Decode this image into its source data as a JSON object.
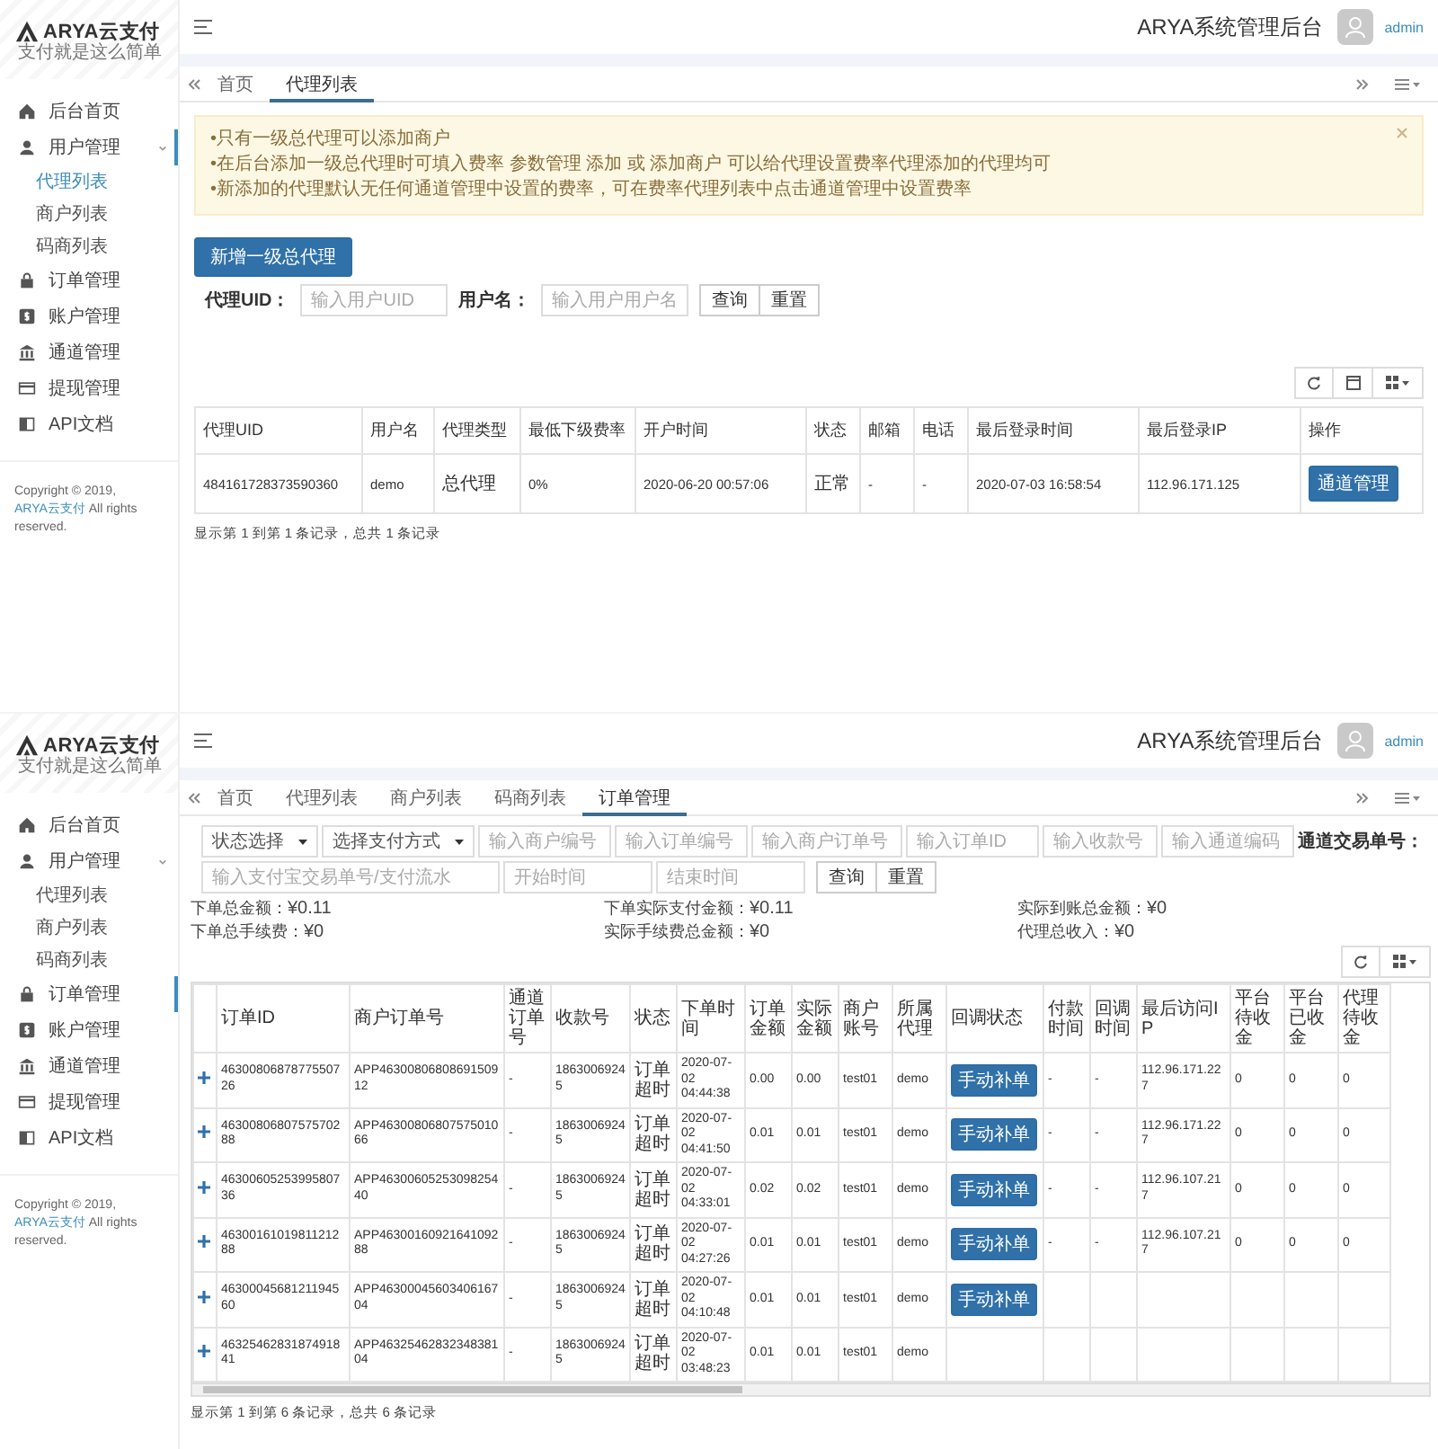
{
  "screens": [
    {
      "kind": "agents",
      "brand": {
        "name": "ARYA云支付",
        "tagline": "支付就是这么简单"
      },
      "sidebar": [
        {
          "label": "后台首页",
          "selected": false
        },
        {
          "label": "用户管理",
          "selected": true,
          "expanded": true,
          "children": [
            {
              "label": "代理列表",
              "selected": true
            },
            {
              "label": "商户列表",
              "selected": false
            },
            {
              "label": "码商列表",
              "selected": false
            }
          ]
        },
        {
          "label": "订单管理",
          "selected": false
        },
        {
          "label": "账户管理",
          "selected": false
        },
        {
          "label": "通道管理",
          "selected": false
        },
        {
          "label": "提现管理",
          "selected": false
        },
        {
          "label": "API文档",
          "selected": false
        }
      ],
      "copyright": {
        "before": "Copyright © 2019, ",
        "link": "ARYA云支付",
        "after": " All rights reserved."
      },
      "header": {
        "title": "ARYA系统管理后台",
        "user": "admin"
      },
      "tabs": [
        {
          "label": "首页",
          "selected": false
        },
        {
          "label": "代理列表",
          "selected": true
        }
      ],
      "alert": [
        "•只有一级总代理可以添加商户",
        "•在后台添加一级总代理时可填入费率 参数管理 添加 或 添加商户 可以给代理设置费率代理添加的代理均可",
        "•新添加的代理默认无任何通道管理中设置的费率，可在费率代理列表中点击通道管理中设置费率"
      ],
      "add_button": "新增一级总代理",
      "filters": [
        {
          "label": "代理UID：",
          "placeholder": "输入用户UID"
        },
        {
          "label": "用户名：",
          "placeholder": "输入用户用户名"
        }
      ],
      "filter_buttons": [
        "查询",
        "重置"
      ],
      "table": {
        "columns": [
          "代理UID",
          "用户名",
          "代理类型",
          "最低下级费率",
          "开户时间",
          "状态",
          "邮箱",
          "电话",
          "最后登录时间",
          "最后登录IP",
          "操作"
        ],
        "rows": [
          {
            "cells": [
              "484161728373590360",
              "demo",
              "总代理",
              "0%",
              "2020-06-20 00:57:06",
              "正常",
              "-",
              "-",
              "2020-07-03 16:58:54",
              "112.96.171.125"
            ],
            "action": "通道管理"
          }
        ]
      },
      "footer": "显示第 1 到第 1 条记录，总共 1 条记录"
    },
    {
      "kind": "orders",
      "brand": {
        "name": "ARYA云支付",
        "tagline": "支付就是这么简单"
      },
      "sidebar": [
        {
          "label": "后台首页",
          "selected": false
        },
        {
          "label": "用户管理",
          "selected": false,
          "expanded": true,
          "children": [
            {
              "label": "代理列表",
              "selected": false
            },
            {
              "label": "商户列表",
              "selected": false
            },
            {
              "label": "码商列表",
              "selected": false
            }
          ]
        },
        {
          "label": "订单管理",
          "selected": true
        },
        {
          "label": "账户管理",
          "selected": false
        },
        {
          "label": "通道管理",
          "selected": false
        },
        {
          "label": "提现管理",
          "selected": false
        },
        {
          "label": "API文档",
          "selected": false
        }
      ],
      "copyright": {
        "before": "Copyright © 2019, ",
        "link": "ARYA云支付",
        "after": " All rights reserved."
      },
      "header": {
        "title": "ARYA系统管理后台",
        "user": "admin"
      },
      "tabs": [
        {
          "label": "首页",
          "selected": false
        },
        {
          "label": "代理列表",
          "selected": false
        },
        {
          "label": "商户列表",
          "selected": false
        },
        {
          "label": "码商列表",
          "selected": false
        },
        {
          "label": "订单管理",
          "selected": true
        }
      ],
      "selects": [
        "状态选择",
        "选择支付方式"
      ],
      "inputs_row1": [
        {
          "placeholder": "输入商户编号"
        },
        {
          "placeholder": "输入订单编号"
        },
        {
          "placeholder": "输入商户订单号"
        },
        {
          "placeholder": "输入订单ID"
        },
        {
          "placeholder": "输入收款号"
        },
        {
          "placeholder": "输入通道编码"
        }
      ],
      "trade_label": "通道交易单号：",
      "inputs_row2": [
        {
          "placeholder": "输入支付宝交易单号/支付流水"
        },
        {
          "placeholder": "开始时间"
        },
        {
          "placeholder": "结束时间"
        }
      ],
      "filter_buttons": [
        "查询",
        "重置"
      ],
      "stats": [
        {
          "label": "下单总金额：",
          "value": "¥0.11"
        },
        {
          "label": "下单实际支付金额：",
          "value": "¥0.11"
        },
        {
          "label": "实际到账总金额：",
          "value": "¥0"
        },
        {
          "label": "下单总手续费：",
          "value": "¥0"
        },
        {
          "label": "实际手续费总金额：",
          "value": "¥0"
        },
        {
          "label": "代理总收入：",
          "value": "¥0"
        }
      ],
      "table": {
        "columns": [
          "订单ID",
          "商户订单号",
          "通道订单号",
          "收款号",
          "状态",
          "下单时间",
          "订单金额",
          "实际金额",
          "商户账号",
          "所属代理",
          "回调状态",
          "付款时间",
          "回调时间",
          "最后访问IP",
          "平台待收金",
          "平台已收金",
          "代理待收金"
        ],
        "rows": [
          {
            "cells": [
              "4630080687877550726",
              "APP4630080680869150912",
              "-",
              "18630069245",
              "订单超时",
              "2020-07-02 04:44:38",
              "0.00",
              "0.00",
              "test01",
              "demo",
              "手动补单",
              "-",
              "-",
              "112.96.171.227",
              "0",
              "0",
              "0"
            ]
          },
          {
            "cells": [
              "4630080680757570288",
              "APP4630080680757501066",
              "-",
              "18630069245",
              "订单超时",
              "2020-07-02 04:41:50",
              "0.01",
              "0.01",
              "test01",
              "demo",
              "手动补单",
              "-",
              "-",
              "112.96.171.227",
              "0",
              "0",
              "0"
            ]
          },
          {
            "cells": [
              "4630060525399580736",
              "APP4630060525309825440",
              "-",
              "18630069245",
              "订单超时",
              "2020-07-02 04:33:01",
              "0.02",
              "0.02",
              "test01",
              "demo",
              "手动补单",
              "-",
              "-",
              "112.96.107.217",
              "0",
              "0",
              "0"
            ]
          },
          {
            "cells": [
              "4630016101981121288",
              "APP4630016092164109288",
              "-",
              "18630069245",
              "订单超时",
              "2020-07-02 04:27:26",
              "0.01",
              "0.01",
              "test01",
              "demo",
              "手动补单",
              "-",
              "-",
              "112.96.107.217",
              "0",
              "0",
              "0"
            ]
          },
          {
            "cells": [
              "4630004568121194560",
              "APP4630004560340616704",
              "-",
              "18630069245",
              "订单超时",
              "2020-07-02 04:10:48",
              "0.01",
              "0.01",
              "test01",
              "demo",
              "手动补单"
            ]
          },
          {
            "cells": [
              "4632546283187491841",
              "APP4632546283234838104",
              "-",
              "18630069245",
              "订单超时",
              "2020-07-02 03:48:23",
              "0.01",
              "0.01",
              "test01",
              "demo"
            ]
          }
        ]
      },
      "footer": "显示第 1 到第 6 条记录，总共 6 条记录"
    }
  ]
}
